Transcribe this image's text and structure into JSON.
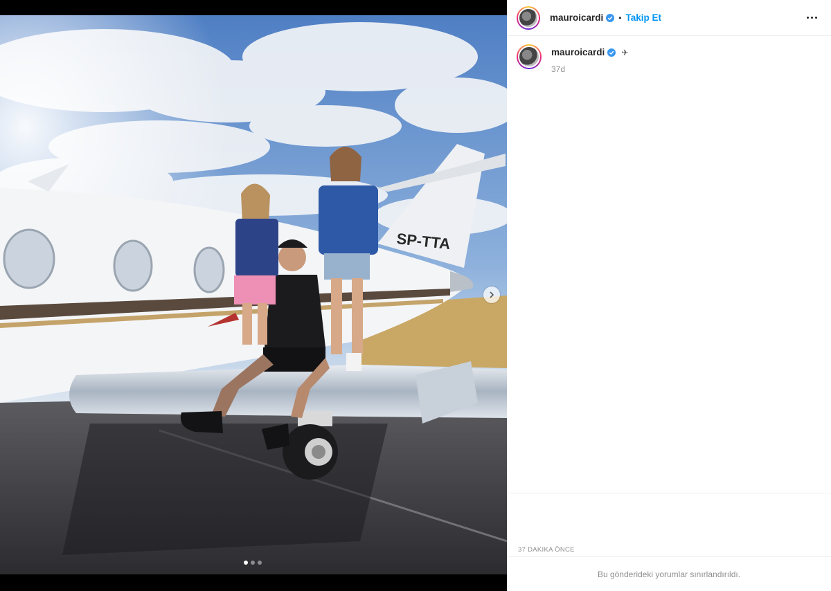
{
  "post": {
    "username": "mauroicardi",
    "follow_label": "Takip Et",
    "separator": "•",
    "caption_username": "mauroicardi",
    "caption_emoji": "✈",
    "caption_time": "37d",
    "time_ago": "37 dakika önce",
    "comments_notice": "Bu gönderideki yorumlar sınırlandırıldı.",
    "aircraft_registration": "SP-TTA"
  },
  "carousel": {
    "total": 3,
    "active_index": 0
  },
  "colors": {
    "accent": "#0095f6",
    "verified": "#3897f0",
    "muted_text": "#8e8e8e"
  }
}
